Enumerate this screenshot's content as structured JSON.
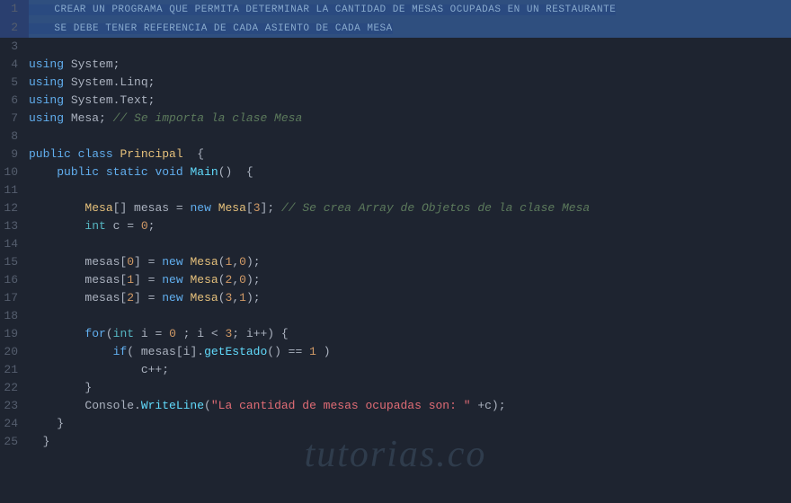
{
  "editor": {
    "background": "#1e2430",
    "watermark": "tutorias.co",
    "lines": [
      {
        "num": 1,
        "highlighted": true,
        "content": "CREAR UN PROGRAMA QUE PERMITA DETERMINAR LA CANTIDAD DE MESAS OCUPADAS EN UN RESTAURANTE"
      },
      {
        "num": 2,
        "highlighted": true,
        "content": "SE DEBE TENER REFERENCIA DE CADA ASIENTO DE CADA MESA"
      },
      {
        "num": 3,
        "content": ""
      },
      {
        "num": 4,
        "content": "using System;"
      },
      {
        "num": 5,
        "content": "using System.Linq;"
      },
      {
        "num": 6,
        "content": "using System.Text;"
      },
      {
        "num": 7,
        "content": "using Mesa; // Se importa la clase Mesa"
      },
      {
        "num": 8,
        "content": ""
      },
      {
        "num": 9,
        "content": "public class Principal  {"
      },
      {
        "num": 10,
        "content": "    public static void Main()  {"
      },
      {
        "num": 11,
        "content": ""
      },
      {
        "num": 12,
        "content": "        Mesa[] mesas = new Mesa[3]; // Se crea Array de Objetos de la clase Mesa"
      },
      {
        "num": 13,
        "content": "        int c = 0;"
      },
      {
        "num": 14,
        "content": ""
      },
      {
        "num": 15,
        "content": "        mesas[0] = new Mesa(1,0);"
      },
      {
        "num": 16,
        "content": "        mesas[1] = new Mesa(2,0);"
      },
      {
        "num": 17,
        "content": "        mesas[2] = new Mesa(3,1);"
      },
      {
        "num": 18,
        "content": ""
      },
      {
        "num": 19,
        "content": "        for(int i = 0 ; i < 3; i++) {"
      },
      {
        "num": 20,
        "content": "            if( mesas[i].getEstado() == 1 )"
      },
      {
        "num": 21,
        "content": "                c++;"
      },
      {
        "num": 22,
        "content": "        }"
      },
      {
        "num": 23,
        "content": "        Console.WriteLine(\"La cantidad de mesas ocupadas son: \" +c);"
      },
      {
        "num": 24,
        "content": "    }"
      },
      {
        "num": 25,
        "content": "}"
      }
    ]
  }
}
